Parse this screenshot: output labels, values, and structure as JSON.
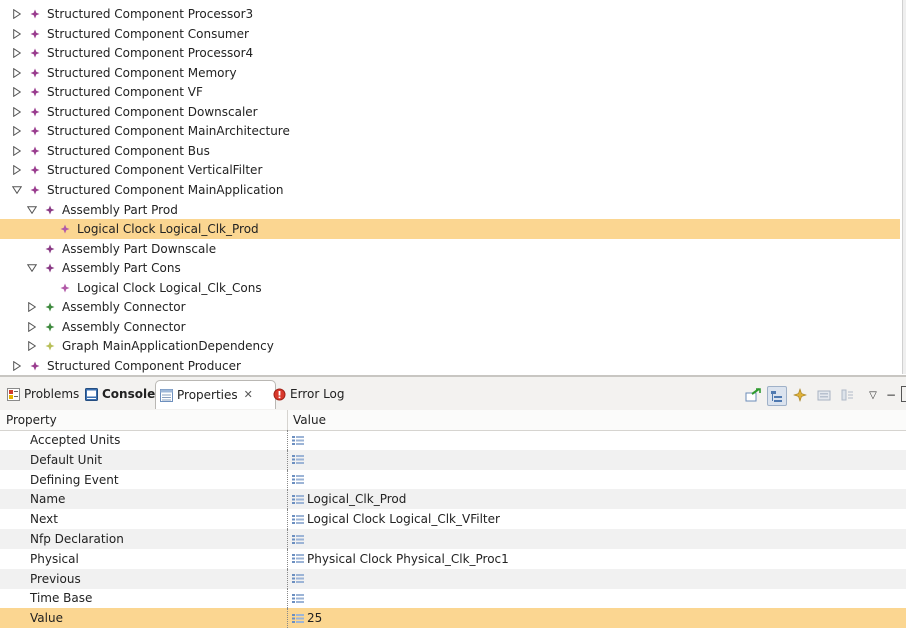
{
  "tree": {
    "rows": [
      {
        "label": "Structured Component Processor3",
        "depth": 0,
        "twisty": "collapsed",
        "icon": "component-icon",
        "icon_color": "#9a3d8f",
        "selected": false
      },
      {
        "label": "Structured Component Consumer",
        "depth": 0,
        "twisty": "collapsed",
        "icon": "component-icon",
        "icon_color": "#9a3d8f",
        "selected": false
      },
      {
        "label": "Structured Component Processor4",
        "depth": 0,
        "twisty": "collapsed",
        "icon": "component-icon",
        "icon_color": "#9a3d8f",
        "selected": false
      },
      {
        "label": "Structured Component Memory",
        "depth": 0,
        "twisty": "collapsed",
        "icon": "component-icon",
        "icon_color": "#9a3d8f",
        "selected": false
      },
      {
        "label": "Structured Component VF",
        "depth": 0,
        "twisty": "collapsed",
        "icon": "component-icon",
        "icon_color": "#9a3d8f",
        "selected": false
      },
      {
        "label": "Structured Component Downscaler",
        "depth": 0,
        "twisty": "collapsed",
        "icon": "component-icon",
        "icon_color": "#9a3d8f",
        "selected": false
      },
      {
        "label": "Structured Component MainArchitecture",
        "depth": 0,
        "twisty": "collapsed",
        "icon": "component-icon",
        "icon_color": "#9a3d8f",
        "selected": false
      },
      {
        "label": "Structured Component Bus",
        "depth": 0,
        "twisty": "collapsed",
        "icon": "component-icon",
        "icon_color": "#9a3d8f",
        "selected": false
      },
      {
        "label": "Structured Component VerticalFilter",
        "depth": 0,
        "twisty": "collapsed",
        "icon": "component-icon",
        "icon_color": "#9a3d8f",
        "selected": false
      },
      {
        "label": "Structured Component MainApplication",
        "depth": 0,
        "twisty": "expanded",
        "icon": "component-icon",
        "icon_color": "#9a3d8f",
        "selected": false
      },
      {
        "label": "Assembly Part Prod",
        "depth": 1,
        "twisty": "expanded",
        "icon": "part-icon",
        "icon_color": "#8a3a86",
        "selected": false
      },
      {
        "label": "Logical Clock Logical_Clk_Prod",
        "depth": 2,
        "twisty": "none",
        "icon": "clock-icon",
        "icon_color": "#b25aa8",
        "selected": true
      },
      {
        "label": "Assembly Part Downscale",
        "depth": 1,
        "twisty": "none",
        "icon": "part-icon",
        "icon_color": "#8a3a86",
        "selected": false
      },
      {
        "label": "Assembly Part Cons",
        "depth": 1,
        "twisty": "expanded",
        "icon": "part-icon",
        "icon_color": "#8a3a86",
        "selected": false
      },
      {
        "label": "Logical Clock Logical_Clk_Cons",
        "depth": 2,
        "twisty": "none",
        "icon": "clock-icon",
        "icon_color": "#b25aa8",
        "selected": false
      },
      {
        "label": "Assembly Connector",
        "depth": 1,
        "twisty": "collapsed",
        "icon": "connector-icon",
        "icon_color": "#3f8a3f",
        "selected": false
      },
      {
        "label": "Assembly Connector",
        "depth": 1,
        "twisty": "collapsed",
        "icon": "connector-icon",
        "icon_color": "#3f8a3f",
        "selected": false
      },
      {
        "label": "Graph MainApplicationDependency",
        "depth": 1,
        "twisty": "collapsed",
        "icon": "graph-icon",
        "icon_color": "#b9c05a",
        "selected": false
      },
      {
        "label": "Structured Component Producer",
        "depth": 0,
        "twisty": "collapsed",
        "icon": "component-icon",
        "icon_color": "#9a3d8f",
        "selected": false
      }
    ]
  },
  "tabs": {
    "problems": "Problems",
    "console": "Console",
    "properties": "Properties",
    "properties_close": "✕",
    "errorlog": "Error Log"
  },
  "toolbar": {
    "menu": "▽",
    "minimize": "−"
  },
  "properties": {
    "col_property": "Property",
    "col_value": "Value",
    "rows": [
      {
        "name": "Accepted Units",
        "value": ""
      },
      {
        "name": "Default Unit",
        "value": ""
      },
      {
        "name": "Defining Event",
        "value": ""
      },
      {
        "name": "Name",
        "value": "Logical_Clk_Prod"
      },
      {
        "name": "Next",
        "value": "Logical Clock Logical_Clk_VFilter"
      },
      {
        "name": "Nfp Declaration",
        "value": ""
      },
      {
        "name": "Physical",
        "value": "Physical Clock Physical_Clk_Proc1"
      },
      {
        "name": "Previous",
        "value": ""
      },
      {
        "name": "Time Base",
        "value": ""
      },
      {
        "name": "Value",
        "value": "25"
      }
    ],
    "selected_row": 9
  }
}
